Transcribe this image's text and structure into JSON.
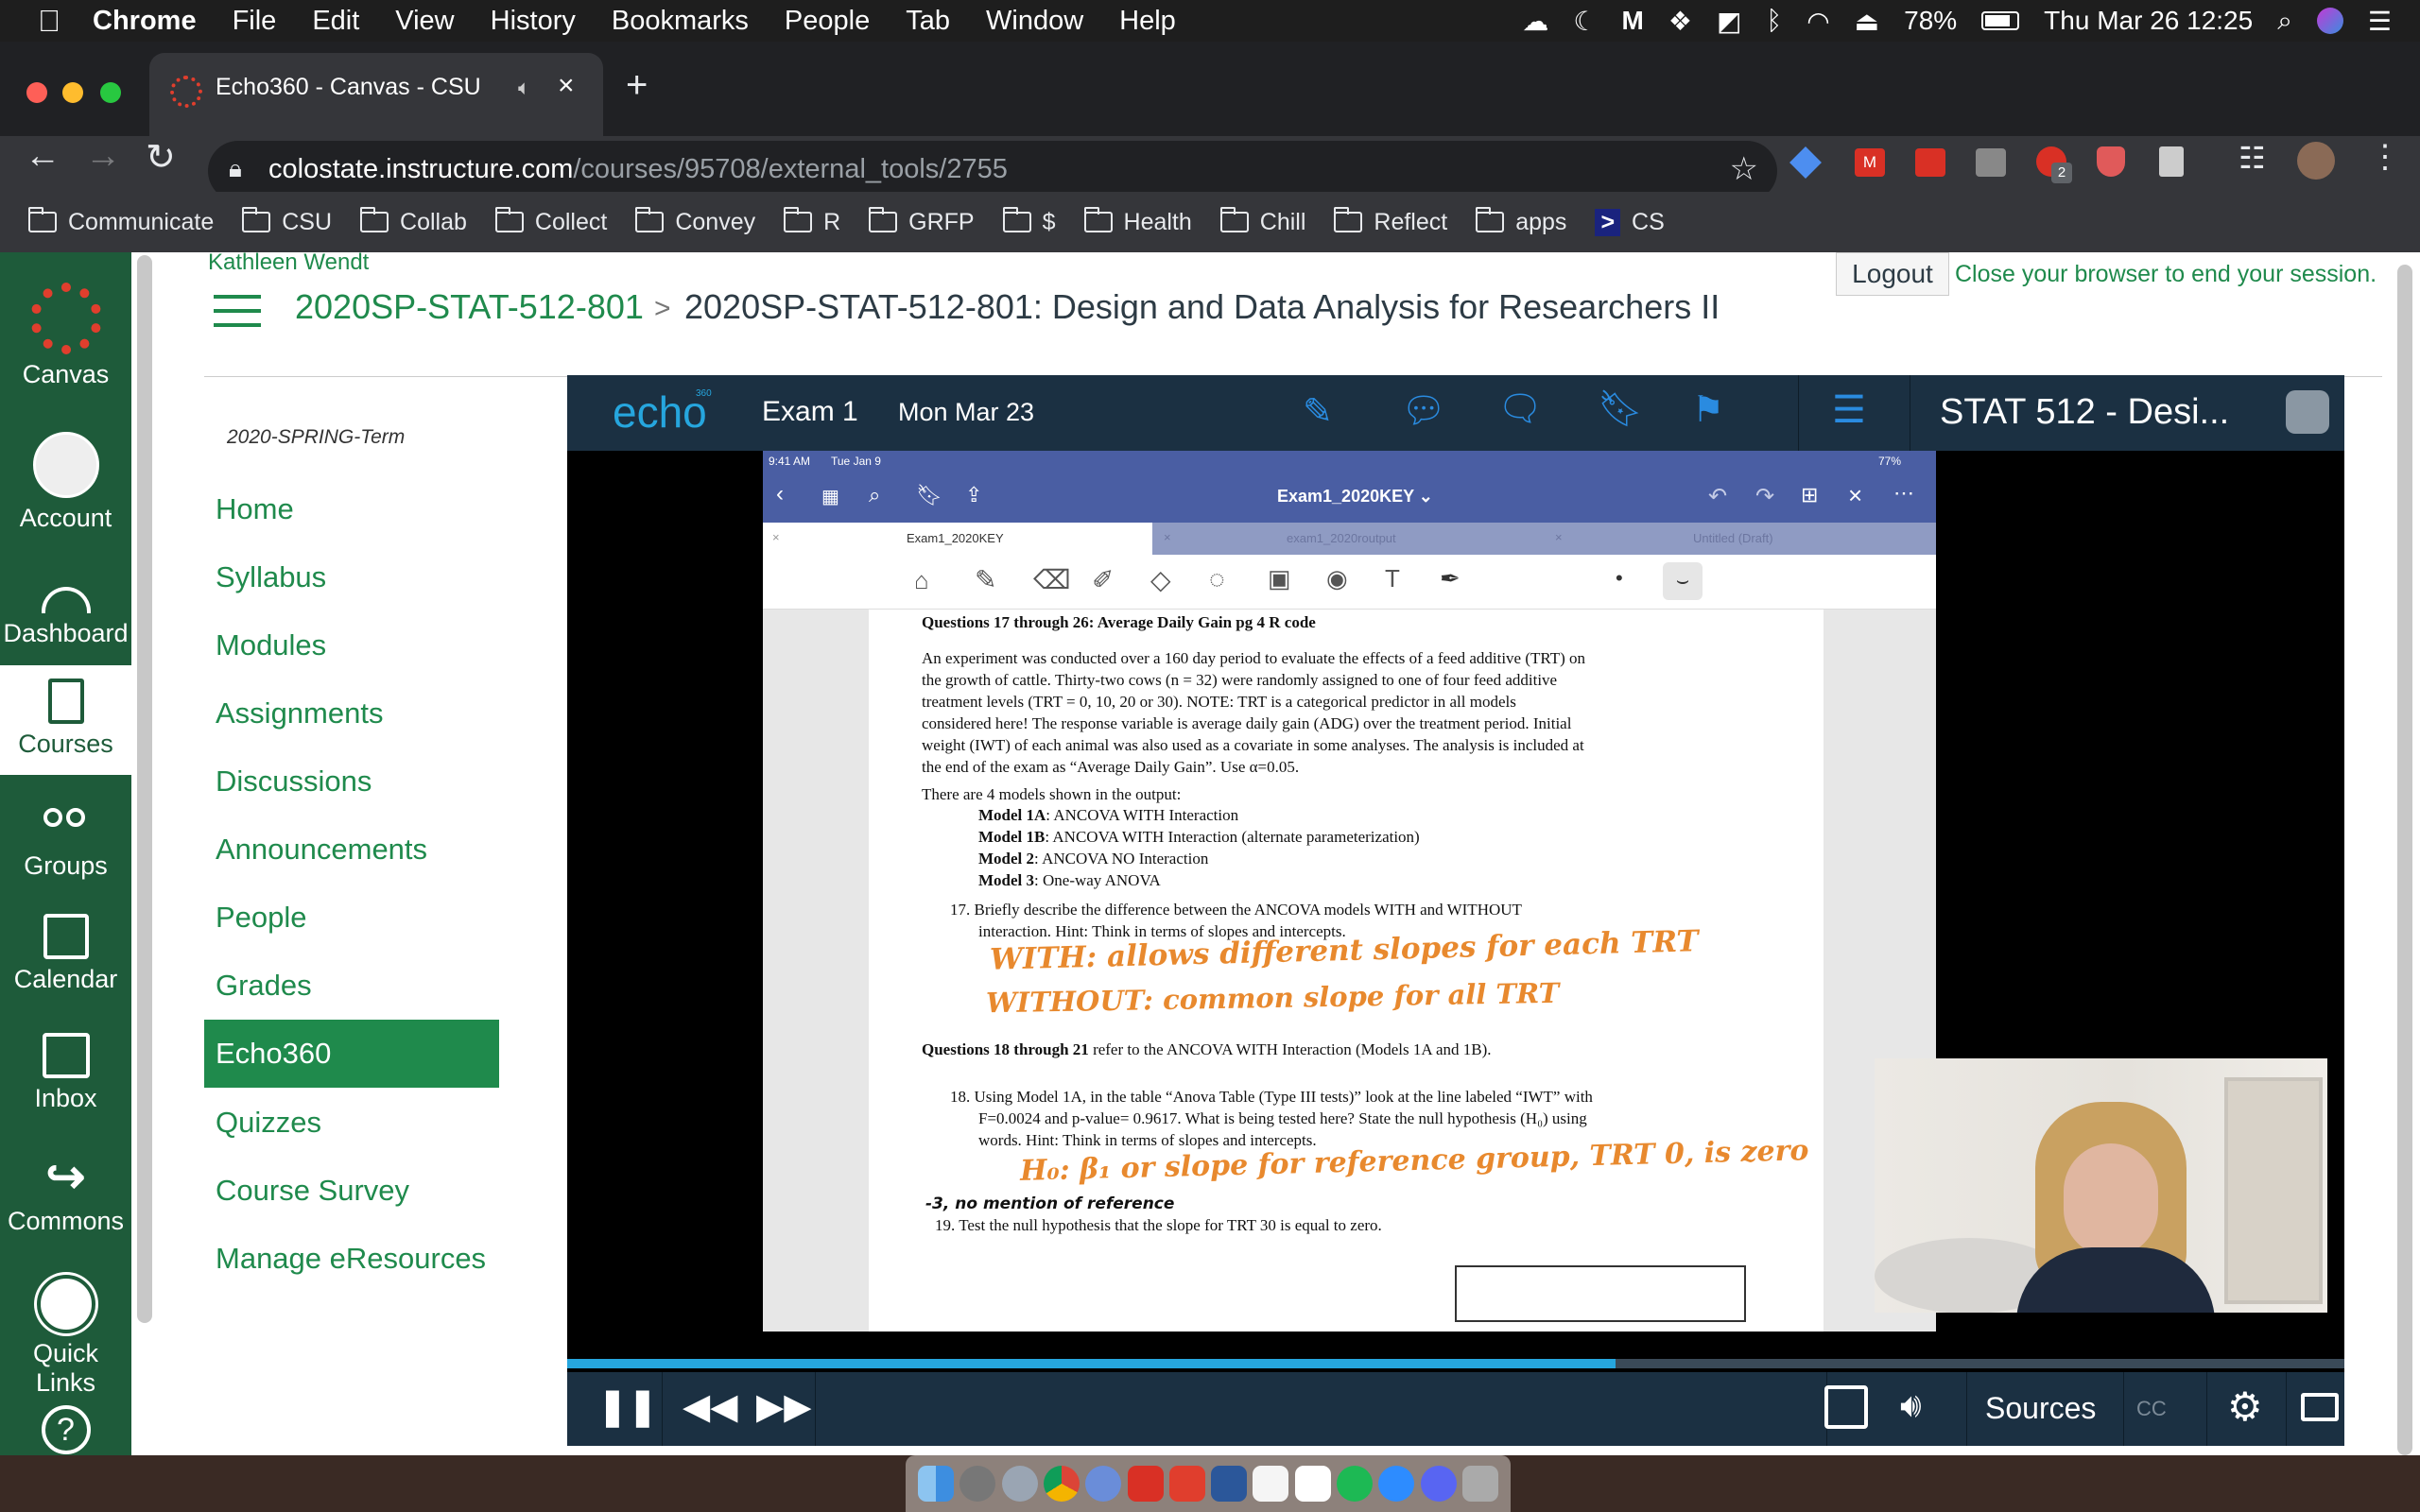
{
  "menubar": {
    "app": "Chrome",
    "items": [
      "File",
      "Edit",
      "View",
      "History",
      "Bookmarks",
      "People",
      "Tab",
      "Window",
      "Help"
    ],
    "battery": "78%",
    "datetime": "Thu Mar 26  12:25"
  },
  "browser": {
    "tab_title": "Echo360 - Canvas - CSU",
    "url_host": "colostate.instructure.com",
    "url_path": "/courses/95708/external_tools/2755",
    "bookmarks": [
      "Communicate",
      "CSU",
      "Collab",
      "Collect",
      "Convey",
      "R",
      "GRFP",
      "$",
      "Health",
      "Chill",
      "Reflect",
      "apps"
    ],
    "bookmark_cs": "CS",
    "ext_badge": "2"
  },
  "global_nav": {
    "items": [
      {
        "label": "Canvas"
      },
      {
        "label": "Account"
      },
      {
        "label": "Dashboard"
      },
      {
        "label": "Courses"
      },
      {
        "label": "Groups"
      },
      {
        "label": "Calendar"
      },
      {
        "label": "Inbox"
      },
      {
        "label": "Commons"
      },
      {
        "label": "Quick Links"
      }
    ],
    "help": "?"
  },
  "header": {
    "user": "Kathleen Wendt",
    "course_code": "2020SP-STAT-512-801",
    "separator": ">",
    "page_title": "2020SP-STAT-512-801: Design and Data Analysis for Researchers II",
    "logout": "Logout",
    "session_note": "Close your browser to end your session."
  },
  "course_nav": {
    "term": "2020-SPRING-Term",
    "items": [
      "Home",
      "Syllabus",
      "Modules",
      "Assignments",
      "Discussions",
      "Announcements",
      "People",
      "Grades",
      "Echo360",
      "Quizzes",
      "Course Survey",
      "Manage eResources"
    ],
    "active": "Echo360"
  },
  "echo": {
    "logo": "echo",
    "logo_sup": "360",
    "lesson": "Exam 1",
    "date": "Mon Mar 23",
    "course_title": "STAT 512 - Desi...",
    "progress": 0.59,
    "sources": "Sources",
    "cc": "CC"
  },
  "ipad": {
    "status_time": "9:41 AM",
    "status_date": "Tue Jan 9",
    "battery": "77%",
    "doc_title": "Exam1_2020KEY ⌄",
    "tabs": [
      "Exam1_2020KEY",
      "exam1_2020routput",
      "Untitled (Draft)"
    ],
    "tab_close": "×"
  },
  "document": {
    "heading": "Questions 17 through 26: Average Daily Gain pg 4 R code",
    "intro": [
      "An experiment was conducted over a 160 day period to evaluate the effects of a feed additive (TRT) on",
      "the growth of cattle. Thirty-two cows (n = 32) were randomly assigned to one of four feed additive",
      "treatment levels (TRT = 0, 10, 20 or 30). NOTE: TRT is a categorical predictor in all models",
      "considered here! The response variable is average daily gain (ADG) over the treatment period. Initial",
      "weight (IWT) of each animal was also used as a covariate in some analyses. The analysis is included at",
      "the end of the exam as “Average Daily Gain”. Use α=0.05."
    ],
    "models_intro": "There are 4 models shown in the output:",
    "models": [
      {
        "name": "Model 1A",
        "desc": ": ANCOVA WITH Interaction"
      },
      {
        "name": "Model 1B",
        "desc": ": ANCOVA WITH Interaction (alternate parameterization)"
      },
      {
        "name": "Model 2",
        "desc": ": ANCOVA NO Interaction"
      },
      {
        "name": "Model 3",
        "desc": ": One-way ANOVA"
      }
    ],
    "q17": [
      "17. Briefly describe the difference between the ANCOVA models WITH and WITHOUT",
      "interaction. Hint: Think in terms of slopes and intercepts."
    ],
    "hw17a": "WITH: allows different slopes for each TRT",
    "hw17b": "WITHOUT: common slope for all TRT",
    "q18_intro_bold": "Questions 18 through 21",
    "q18_intro_rest": " refer to the ANCOVA WITH Interaction (Models 1A and 1B).",
    "q18": [
      "18. Using Model 1A, in the table “Anova Table (Type III tests)” look at the line labeled “IWT” with",
      "F=0.0024 and p-value= 0.9617. What is being tested here? State the null hypothesis (H₀) using",
      "words. Hint: Think in terms of slopes and intercepts."
    ],
    "hw18": "H₀: β₁ or slope for reference group, TRT 0, is zero",
    "hw18_note": "-3, no mention of reference",
    "q19": "19. Test the null hypothesis that the slope for TRT 30 is equal to zero."
  },
  "colors": {
    "canvas_green": "#1e5b3a",
    "link_green": "#1f8a4c",
    "echo_bar": "#1b3042",
    "echo_blue": "#26a6de",
    "handwriting": "#e8892e"
  }
}
